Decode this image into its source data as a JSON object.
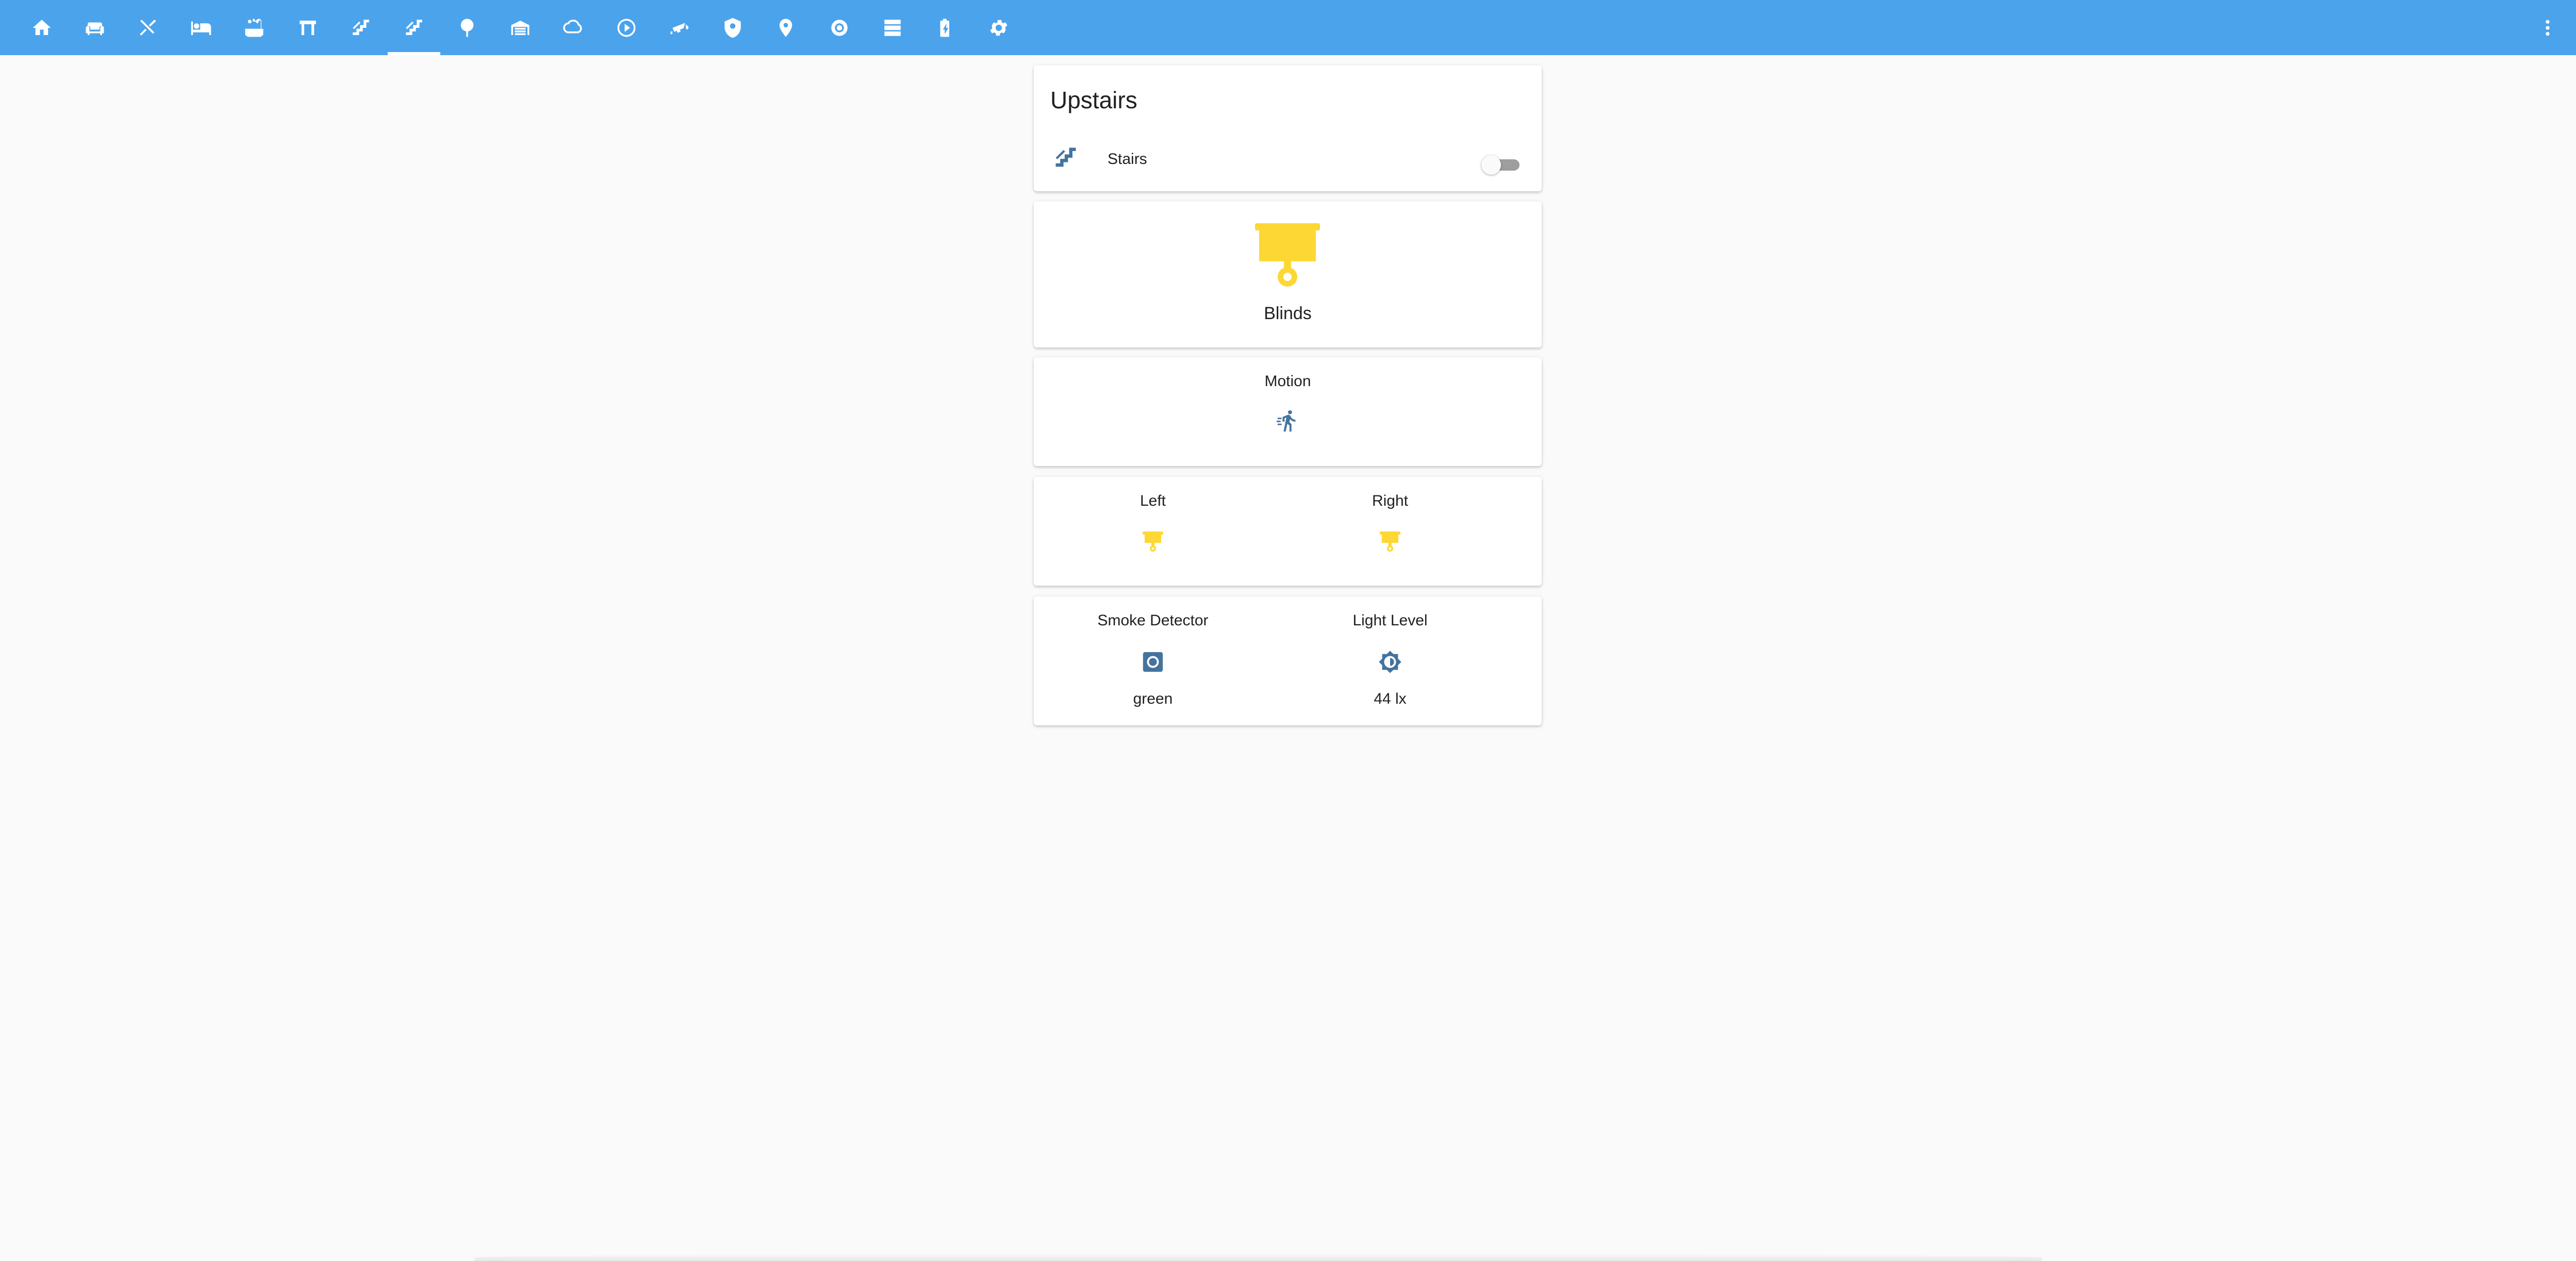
{
  "theme": {
    "header_color": "#4ba3ec",
    "background": "#fafafa",
    "state_on_color": "#fdd835",
    "icon_color": "#44739e"
  },
  "tabs": [
    {
      "icon": "home-icon"
    },
    {
      "icon": "sofa-icon"
    },
    {
      "icon": "silverware-icon"
    },
    {
      "icon": "bed-icon"
    },
    {
      "icon": "bathtub-icon"
    },
    {
      "icon": "gate-icon"
    },
    {
      "icon": "stairs-icon"
    },
    {
      "icon": "stairs-up-icon",
      "active": true
    },
    {
      "icon": "tree-icon"
    },
    {
      "icon": "garage-icon"
    },
    {
      "icon": "weather-icon"
    },
    {
      "icon": "play-circle-icon"
    },
    {
      "icon": "cctv-icon"
    },
    {
      "icon": "shield-icon"
    },
    {
      "icon": "map-marker-icon"
    },
    {
      "icon": "robot-vacuum-icon"
    },
    {
      "icon": "server-icon"
    },
    {
      "icon": "battery-charging-icon"
    },
    {
      "icon": "settings-icon"
    }
  ],
  "upstairs_card": {
    "title": "Upstairs",
    "entity_label": "Stairs",
    "entity_icon": "stairs-icon",
    "toggle_on": false
  },
  "blinds_card": {
    "label": "Blinds",
    "icon": "ceiling-light-icon"
  },
  "motion_card": {
    "label": "Motion",
    "icon": "run-icon"
  },
  "lights_card": {
    "left_label": "Left",
    "right_label": "Right",
    "icon": "ceiling-light-icon"
  },
  "sensors_card": {
    "smoke_label": "Smoke Detector",
    "smoke_state": "green",
    "smoke_icon": "smoke-detector-icon",
    "light_label": "Light Level",
    "light_state": "44 lx",
    "light_icon": "brightness-icon"
  }
}
